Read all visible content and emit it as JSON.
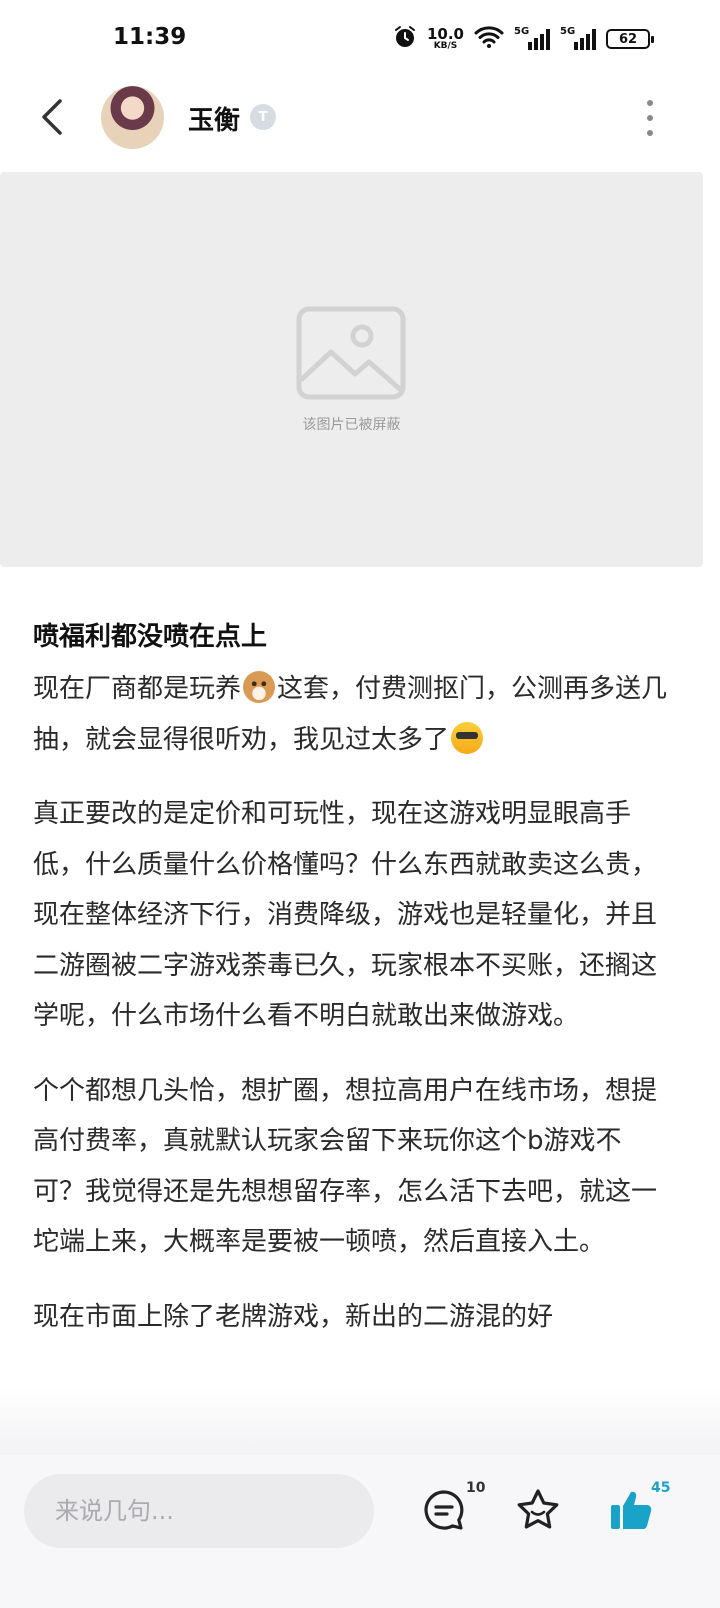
{
  "status_bar": {
    "time": "11:39",
    "net_speed_value": "10.0",
    "net_speed_unit": "KB/S",
    "signal_1_label": "5G",
    "signal_2_label": "5G",
    "battery": "62",
    "icons": [
      "alarm-icon",
      "wifi-icon",
      "signal-icon",
      "signal-icon",
      "battery-icon"
    ]
  },
  "header": {
    "author_name": "玉衡",
    "level_badge": "T",
    "icons": [
      "back-arrow-icon",
      "more-vertical-icon"
    ]
  },
  "blocked_image": {
    "text": "该图片已被屏蔽",
    "icon": "image-placeholder-icon"
  },
  "post": {
    "title": "喷福利都没喷在点上",
    "para1_a": "现在厂商都是玩养",
    "para1_b": "这套，付费测抠门，公测再多送几抽，就会显得很听劝，我见过太多了",
    "para2": "真正要改的是定价和可玩性，现在这游戏明显眼高手低，什么质量什么价格懂吗？什么东西就敢卖这么贵，现在整体经济下行，消费降级，游戏也是轻量化，并且二游圈被二字游戏荼毒已久，玩家根本不买账，还搁这学呢，什么市场什么看不明白就敢出来做游戏。",
    "para3": "个个都想几头恰，想扩圈，想拉高用户在线市场，想提高付费率，真就默认玩家会留下来玩你这个b游戏不可？我觉得还是先想想留存率，怎么活下去吧，就这一坨端上来，大概率是要被一顿喷，然后直接入土。",
    "para4": "现在市面上除了老牌游戏，新出的二游混的好"
  },
  "bottom_bar": {
    "input_placeholder": "来说几句...",
    "comment_count": "10",
    "like_count": "45",
    "icons": [
      "comment-icon",
      "star-icon",
      "thumbs-up-icon"
    ],
    "accent_color": "#1aa3c9"
  }
}
